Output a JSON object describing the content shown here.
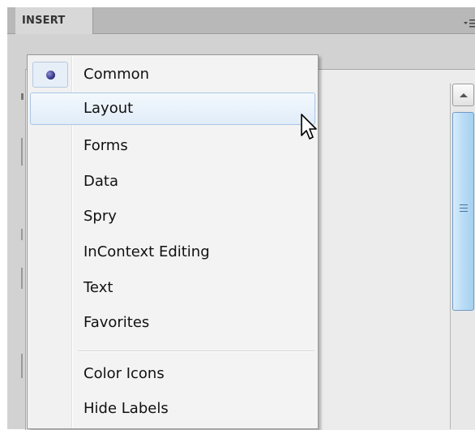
{
  "panel": {
    "tab_label": "INSERT",
    "menu_icon": "panel-options-icon"
  },
  "menu": {
    "items": [
      {
        "label": "Common",
        "checked": true,
        "highlighted": false
      },
      {
        "label": "Layout",
        "checked": false,
        "highlighted": true
      },
      {
        "label": "Forms",
        "checked": false,
        "highlighted": false
      },
      {
        "label": "Data",
        "checked": false,
        "highlighted": false
      },
      {
        "label": "Spry",
        "checked": false,
        "highlighted": false
      },
      {
        "label": "InContext Editing",
        "checked": false,
        "highlighted": false
      },
      {
        "label": "Text",
        "checked": false,
        "highlighted": false
      },
      {
        "label": "Favorites",
        "checked": false,
        "highlighted": false
      }
    ],
    "options": [
      {
        "label": "Color Icons"
      },
      {
        "label": "Hide Labels"
      }
    ]
  },
  "colors": {
    "highlight_border": "#a9c7e6",
    "scroll_thumb": "#b9dcf6",
    "check_dot": "#2b2b7a"
  }
}
